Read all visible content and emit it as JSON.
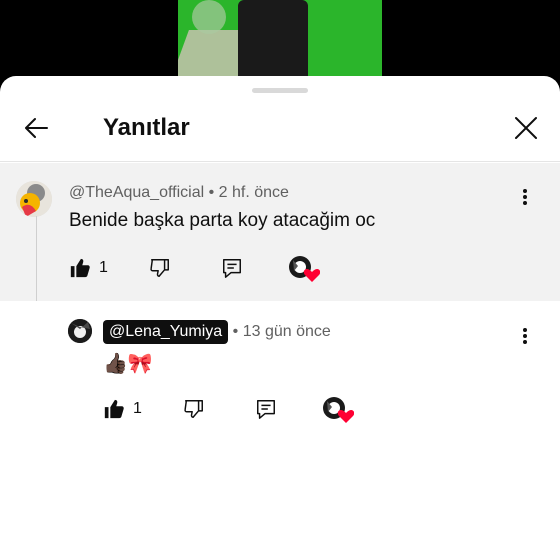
{
  "header": {
    "title": "Yanıtlar"
  },
  "parent": {
    "author": "@TheAqua_official",
    "time": "2 hf. önce",
    "text": "Benide başka parta koy atacağim oc",
    "likes": "1"
  },
  "reply": {
    "author": "@Lena_Yumiya",
    "time": "13 gün önce",
    "text": "👍🏿🎀",
    "likes": "1"
  },
  "separator": "•",
  "colors": {
    "heart": "#ff0033",
    "page": "#ffffff",
    "parent_bg": "#f2f2f2",
    "video_green": "#2bb52b"
  }
}
